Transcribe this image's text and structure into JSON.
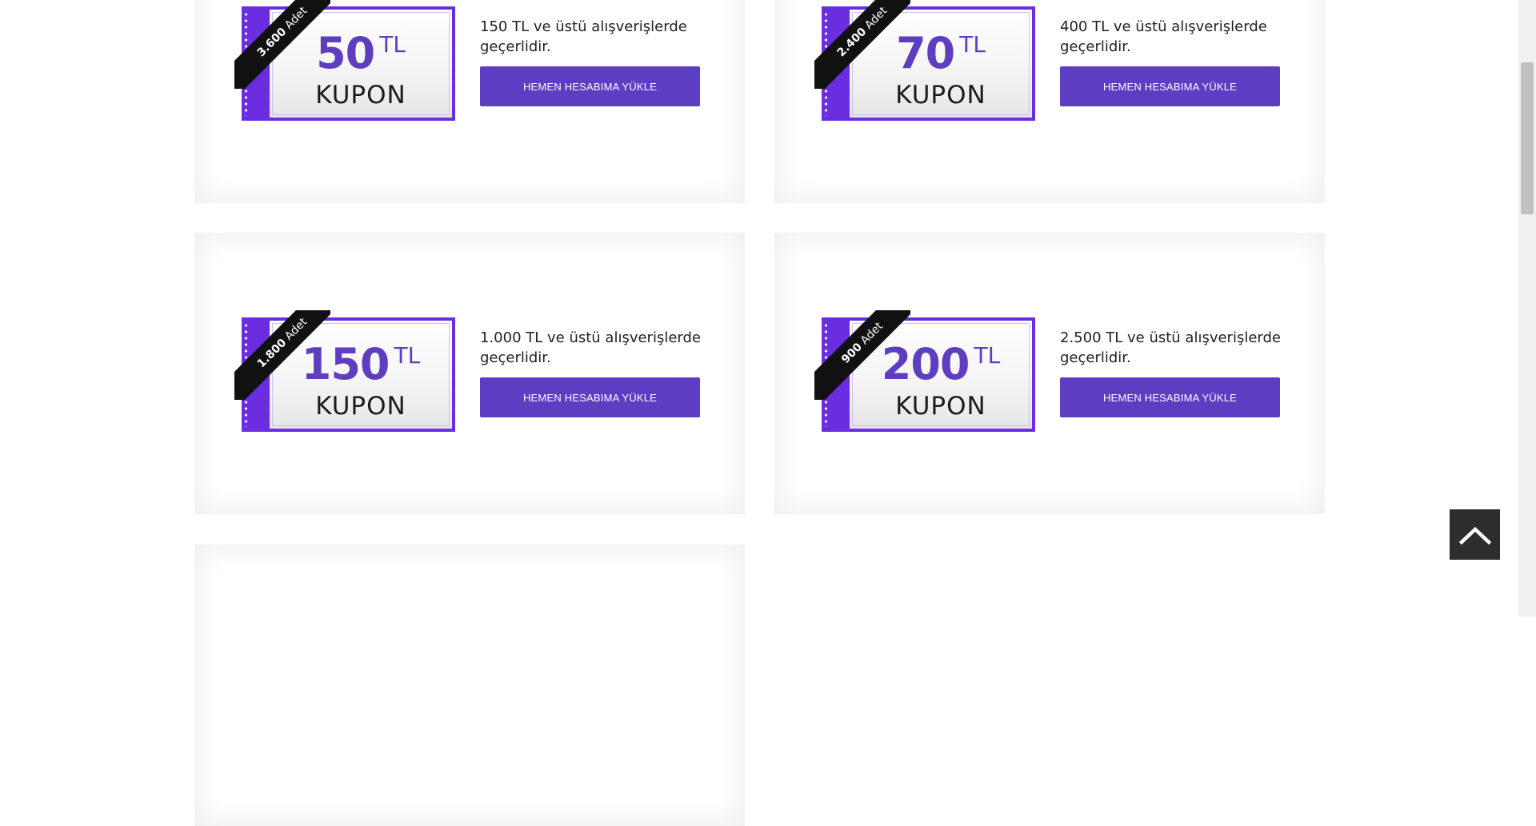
{
  "coupons": [
    {
      "amount": "50",
      "currency": "TL",
      "kupon_label": "KUPON",
      "count": "3.600",
      "count_unit": "Adet",
      "description": "150 TL ve üstü alışverişlerde geçerlidir.",
      "button_label": "HEMEN HESABIMA YÜKLE"
    },
    {
      "amount": "70",
      "currency": "TL",
      "kupon_label": "KUPON",
      "count": "2.400",
      "count_unit": "Adet",
      "description": "400 TL ve üstü alışverişlerde geçerlidir.",
      "button_label": "HEMEN HESABIMA YÜKLE"
    },
    {
      "amount": "150",
      "currency": "TL",
      "kupon_label": "KUPON",
      "count": "1.800",
      "count_unit": "Adet",
      "description": "1.000 TL ve üstü alışverişlerde geçerlidir.",
      "button_label": "HEMEN HESABIMA YÜKLE"
    },
    {
      "amount": "200",
      "currency": "TL",
      "kupon_label": "KUPON",
      "count": "900",
      "count_unit": "Adet",
      "description": "2.500 TL ve üstü alışverişlerde geçerlidir.",
      "button_label": "HEMEN HESABIMA YÜKLE"
    }
  ],
  "scroll_top": {
    "icon": "chevron-up-icon"
  },
  "colors": {
    "accent": "#5b3ec2",
    "coupon_border": "#6a2ddf",
    "ribbon": "#111111",
    "scroll_top_bg": "#2d2d2d"
  }
}
